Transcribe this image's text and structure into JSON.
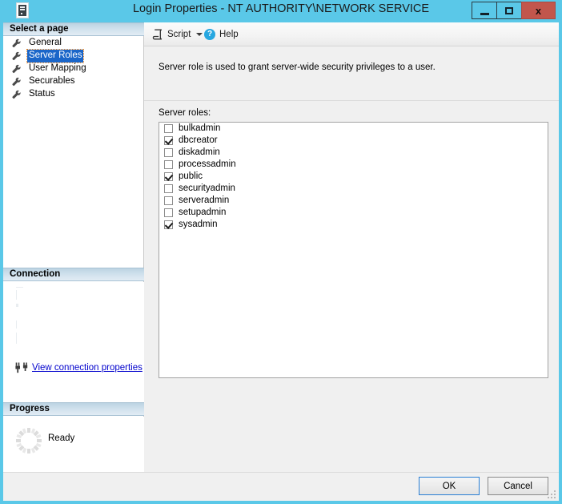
{
  "window": {
    "title": "Login Properties - NT AUTHORITY\\NETWORK SERVICE",
    "icon": "server-icon",
    "controls": {
      "minimize": "–",
      "maximize": "□",
      "close": "x"
    },
    "accent_color": "#5ac8e8",
    "close_color": "#c2564c"
  },
  "sidebar": {
    "select_page_header": "Select a page",
    "items": [
      {
        "label": "General",
        "icon": "wrench-icon",
        "selected": false
      },
      {
        "label": "Server Roles",
        "icon": "wrench-icon",
        "selected": true
      },
      {
        "label": "User Mapping",
        "icon": "wrench-icon",
        "selected": false
      },
      {
        "label": "Securables",
        "icon": "wrench-icon",
        "selected": false
      },
      {
        "label": "Status",
        "icon": "wrench-icon",
        "selected": false
      }
    ],
    "connection": {
      "header": "Connection",
      "link_label": "View connection properties",
      "link_icon": "plug-icon",
      "link_color": "#0000cc"
    },
    "progress": {
      "header": "Progress",
      "status": "Ready",
      "icon": "spinner-icon"
    }
  },
  "toolbar": {
    "script_label": "Script",
    "script_icon": "script-icon",
    "script_caret_icon": "chevron-down-icon",
    "help_label": "Help",
    "help_icon": "help-circle-icon"
  },
  "main": {
    "description": "Server role is used to grant server-wide security privileges to a user.",
    "roles_label": "Server roles:",
    "roles": [
      {
        "name": "bulkadmin",
        "checked": false
      },
      {
        "name": "dbcreator",
        "checked": true
      },
      {
        "name": "diskadmin",
        "checked": false
      },
      {
        "name": "processadmin",
        "checked": false
      },
      {
        "name": "public",
        "checked": true
      },
      {
        "name": "securityadmin",
        "checked": false
      },
      {
        "name": "serveradmin",
        "checked": false
      },
      {
        "name": "setupadmin",
        "checked": false
      },
      {
        "name": "sysadmin",
        "checked": true
      }
    ]
  },
  "footer": {
    "ok_label": "OK",
    "cancel_label": "Cancel",
    "default_button": "OK"
  }
}
